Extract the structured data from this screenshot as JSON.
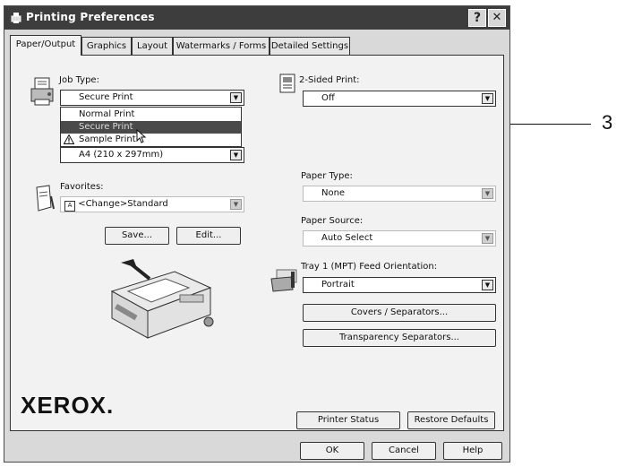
{
  "window": {
    "title": "Printing Preferences",
    "help_glyph": "?",
    "close_glyph": "✕"
  },
  "tabs": [
    {
      "label": "Paper/Output"
    },
    {
      "label": "Graphics"
    },
    {
      "label": "Layout"
    },
    {
      "label": "Watermarks / Forms"
    },
    {
      "label": "Detailed Settings"
    }
  ],
  "job_type": {
    "label": "Job Type:",
    "value": "Secure Print",
    "options": [
      "Normal Print",
      "Secure Print",
      "Sample Print"
    ]
  },
  "paper_size": {
    "value": "A4 (210 x 297mm)"
  },
  "favorites": {
    "label": "Favorites:",
    "value": "<Change>Standard",
    "save": "Save...",
    "edit": "Edit..."
  },
  "two_sided": {
    "label": "2-Sided Print:",
    "value": "Off"
  },
  "paper_type": {
    "label": "Paper Type:",
    "value": "None"
  },
  "paper_source": {
    "label": "Paper Source:",
    "value": "Auto Select"
  },
  "tray_orientation": {
    "label": "Tray 1 (MPT) Feed Orientation:",
    "value": "Portrait"
  },
  "buttons": {
    "covers": "Covers / Separators...",
    "transparency": "Transparency Separators...",
    "printer_status": "Printer Status",
    "restore_defaults": "Restore Defaults",
    "ok": "OK",
    "cancel": "Cancel",
    "help": "Help"
  },
  "brand": "XEROX.",
  "callout": {
    "number": "3"
  },
  "icons": [
    "printer-app-icon",
    "job-type-icon",
    "warning-icon",
    "mouse-cursor-icon",
    "duplex-icon",
    "favorites-icon",
    "printer-illustration",
    "tray-orientation-icon"
  ]
}
